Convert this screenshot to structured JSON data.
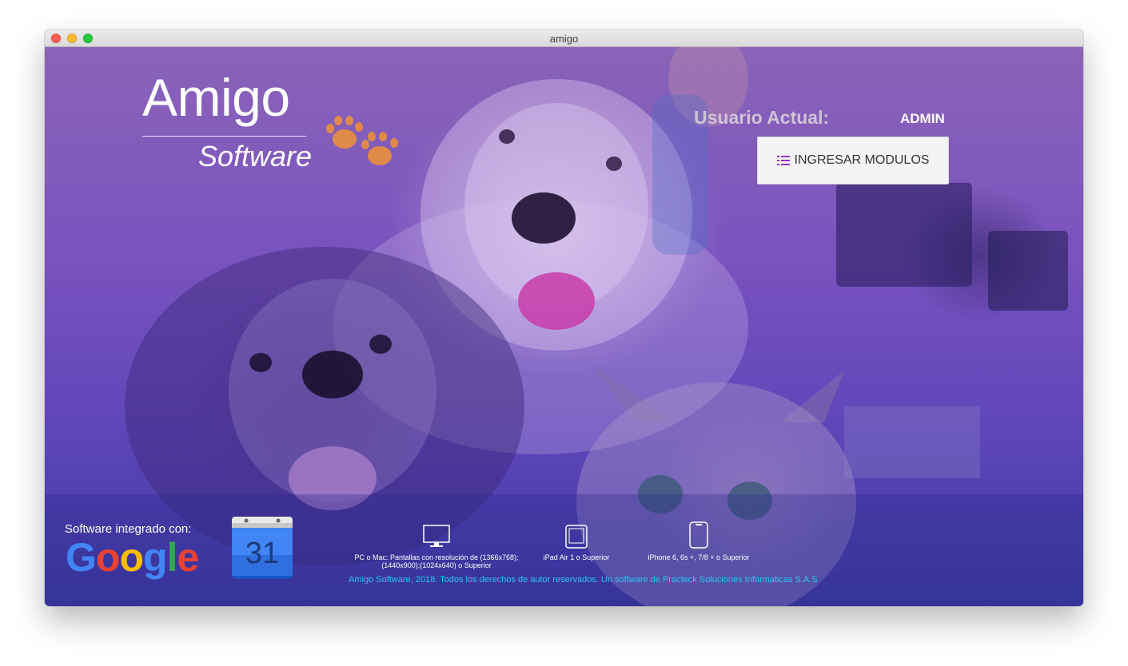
{
  "window": {
    "title": "amigo"
  },
  "brand": {
    "name": "Amigo",
    "subtitle": "Software",
    "paw_icon": "paw-icon",
    "paw_color": "#e08a4a"
  },
  "user": {
    "label": "Usuario Actual:",
    "value": "ADMIN"
  },
  "actions": {
    "modules_button": "INGRESAR MODULOS",
    "modules_icon": "list-icon",
    "modules_icon_color": "#9a30c8"
  },
  "footer": {
    "integrated_label": "Software integrado con:",
    "google_logo": "Google",
    "calendar_day": "31",
    "devices": [
      {
        "icon": "desktop-icon",
        "line1": "PC o Mac: Pantallas con resolución de (1366x768);",
        "line2": "(1440x900);(1024x640) o Superior"
      },
      {
        "icon": "tablet-icon",
        "line1": "iPad Air 1 o Superior",
        "line2": ""
      },
      {
        "icon": "phone-icon",
        "line1": "iPhone 6, 6s +, 7/8 + o Superior",
        "line2": ""
      }
    ],
    "copyright": "Amigo Software, 2018. Todos los derechos de autor reservados. Un software de Practeck Soluciones Informaticas S.A.S",
    "copyright_color": "#29c8f0"
  },
  "colors": {
    "overlay": "#6a4cc0",
    "google_blue": "#4285f4",
    "google_red": "#ea4335",
    "google_yellow": "#fbbc05",
    "google_green": "#34a853"
  }
}
